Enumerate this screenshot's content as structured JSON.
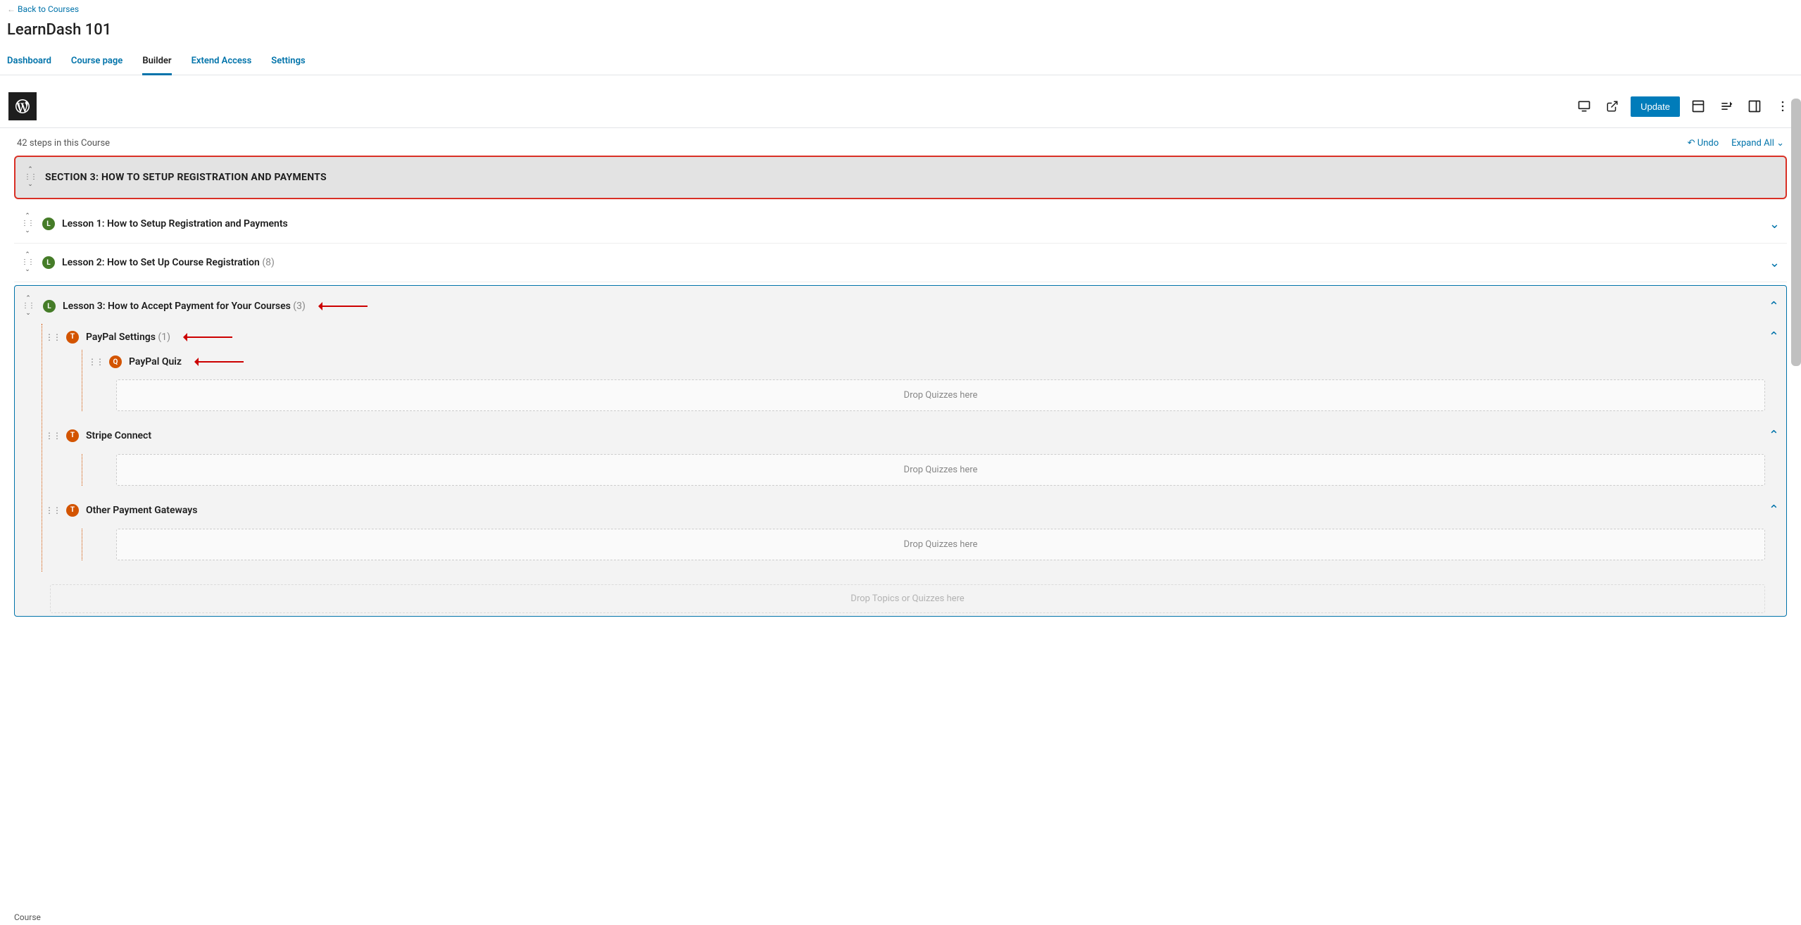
{
  "back_link": "Back to Courses",
  "course_title": "LearnDash 101",
  "tabs": {
    "dashboard": "Dashboard",
    "course_page": "Course page",
    "builder": "Builder",
    "extend": "Extend Access",
    "settings": "Settings"
  },
  "update_btn": "Update",
  "status": {
    "steps": "42 steps in this Course",
    "undo": "Undo",
    "expand": "Expand All ⌄"
  },
  "section": {
    "title": "SECTION 3: HOW TO SETUP REGISTRATION AND PAYMENTS"
  },
  "lessons": {
    "l1": "Lesson 1: How to Setup Registration and Payments",
    "l2": "Lesson 2: How to Set Up Course Registration",
    "l2_count": "(8)",
    "l3": "Lesson 3: How to Accept Payment for Your Courses",
    "l3_count": "(3)"
  },
  "topics": {
    "paypal": "PayPal Settings",
    "paypal_count": "(1)",
    "paypal_quiz": "PayPal Quiz",
    "stripe": "Stripe Connect",
    "other": "Other Payment Gateways"
  },
  "drop": {
    "quizzes": "Drop Quizzes here",
    "topics_quizzes": "Drop Topics or Quizzes here"
  },
  "footer": "Course"
}
